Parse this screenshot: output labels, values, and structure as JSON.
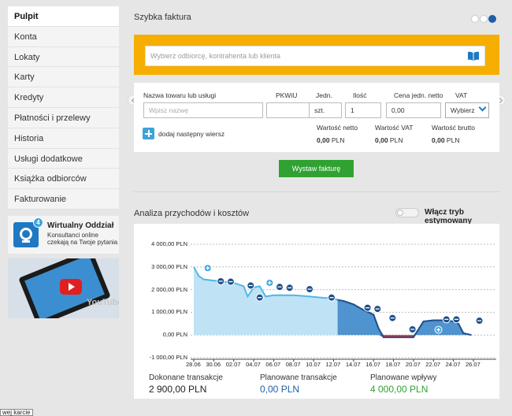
{
  "sidebar": {
    "items": [
      {
        "label": "Pulpit",
        "active": true
      },
      {
        "label": "Konta"
      },
      {
        "label": "Lokaty"
      },
      {
        "label": "Karty"
      },
      {
        "label": "Kredyty"
      },
      {
        "label": "Płatności i przelewy"
      },
      {
        "label": "Historia"
      },
      {
        "label": "Usługi dodatkowe"
      },
      {
        "label": "Książka odbiorców"
      },
      {
        "label": "Fakturowanie"
      }
    ],
    "virtual_office": {
      "badge": "4",
      "title": "Wirtualny Oddział",
      "subtitle": "Konsultanci online czekają na Twoje pytania"
    },
    "video": {
      "watermark": "YouTube"
    }
  },
  "invoice": {
    "title": "Szybka faktura",
    "carousel_dots": 3,
    "recipient_placeholder": "Wybierz odbiorcę, kontrahenta lub klienta",
    "columns": {
      "name": "Nazwa towaru lub usługi",
      "pkwiu": "PKWiU",
      "unit": "Jedn.",
      "qty": "Ilość",
      "price": "Cena jedn. netto",
      "vat": "VAT"
    },
    "row": {
      "name_placeholder": "Wpisz nazwę",
      "unit": "szt.",
      "qty": "1",
      "price": "0,00",
      "vat": "Wybierz"
    },
    "add_row": "dodaj następny wiersz",
    "totals": [
      {
        "label": "Wartość netto",
        "value": "0,00",
        "currency": "PLN"
      },
      {
        "label": "Wartość VAT",
        "value": "0,00",
        "currency": "PLN"
      },
      {
        "label": "Wartość brutto",
        "value": "0,00",
        "currency": "PLN"
      }
    ],
    "submit": "Wystaw fakturę"
  },
  "analysis": {
    "title": "Analiza przychodów i kosztów",
    "toggle_label": "Włącz tryb estymowany",
    "toggle_on": false,
    "stats": [
      {
        "label": "Dokonane transakcje",
        "value": "2 900,00 PLN",
        "color": "#222222"
      },
      {
        "label": "Planowane transakcje",
        "value": "0,00 PLN",
        "color": "#1e5fa8"
      },
      {
        "label": "Planowane wpływy",
        "value": "4 000,00 PLN",
        "color": "#2fa232"
      }
    ]
  },
  "chart_data": {
    "type": "area",
    "y_tick_labels": [
      "4 000,00 PLN",
      "3 000,00 PLN",
      "2 000,00 PLN",
      "1 000,00 PLN",
      "0,00 PLN",
      "-1 000,00 PLN"
    ],
    "y_ticks": [
      4000,
      3000,
      2000,
      1000,
      0,
      -1000
    ],
    "ylim": [
      -1000,
      4000
    ],
    "x_tick_labels": [
      "28.06",
      "30.06",
      "02.07",
      "04.07",
      "06.07",
      "08.07",
      "10.07",
      "12.07",
      "14.07",
      "16.07",
      "18.07",
      "20.07",
      "22.07",
      "24.07",
      "26.07"
    ],
    "x_days": [
      0,
      2,
      4,
      6,
      8,
      10,
      12,
      14,
      16,
      18,
      20,
      22,
      24,
      26,
      28
    ],
    "series": [
      {
        "kind": "actual",
        "points": [
          [
            0,
            3000
          ],
          [
            0.5,
            2600
          ],
          [
            1,
            2450
          ],
          [
            2,
            2400
          ],
          [
            3,
            2350
          ],
          [
            4,
            2300
          ],
          [
            5,
            2150
          ],
          [
            5.4,
            1700
          ],
          [
            6,
            2100
          ],
          [
            6.6,
            2150
          ],
          [
            7.2,
            1700
          ],
          [
            8,
            1750
          ],
          [
            9,
            1750
          ],
          [
            10,
            1750
          ],
          [
            11,
            1720
          ],
          [
            12,
            1680
          ],
          [
            13,
            1640
          ],
          [
            14,
            1620
          ],
          [
            14.4,
            1550
          ]
        ],
        "color": "#4db8e6"
      },
      {
        "kind": "planned",
        "points": [
          [
            14.4,
            1550
          ],
          [
            15,
            1500
          ],
          [
            16,
            1350
          ],
          [
            17,
            1100
          ],
          [
            18,
            900
          ],
          [
            18.5,
            300
          ],
          [
            19,
            -100
          ],
          [
            20,
            -100
          ],
          [
            21,
            -100
          ],
          [
            22,
            -100
          ],
          [
            22.5,
            250
          ],
          [
            23,
            600
          ],
          [
            24,
            650
          ],
          [
            25,
            650
          ],
          [
            26,
            600
          ],
          [
            26.5,
            500
          ],
          [
            27,
            80
          ],
          [
            27.8,
            0
          ]
        ],
        "color": "#1d4f8c"
      }
    ],
    "markers": [
      {
        "x": 1.4,
        "y": 2950,
        "kind": "plus"
      },
      {
        "x": 2.7,
        "y": 2370,
        "kind": "minus"
      },
      {
        "x": 3.7,
        "y": 2350,
        "kind": "minus"
      },
      {
        "x": 5.7,
        "y": 2180,
        "kind": "minus"
      },
      {
        "x": 6.6,
        "y": 1650,
        "kind": "minus"
      },
      {
        "x": 7.6,
        "y": 2300,
        "kind": "plus"
      },
      {
        "x": 8.6,
        "y": 2120,
        "kind": "minus"
      },
      {
        "x": 9.6,
        "y": 2080,
        "kind": "minus"
      },
      {
        "x": 11.6,
        "y": 2020,
        "kind": "minus"
      },
      {
        "x": 13.8,
        "y": 1650,
        "kind": "minus"
      },
      {
        "x": 17.4,
        "y": 1200,
        "kind": "minus"
      },
      {
        "x": 18.4,
        "y": 1150,
        "kind": "minus"
      },
      {
        "x": 19.9,
        "y": 750,
        "kind": "minus"
      },
      {
        "x": 21.9,
        "y": 250,
        "kind": "minus"
      },
      {
        "x": 24.5,
        "y": 230,
        "kind": "plus"
      },
      {
        "x": 25.3,
        "y": 690,
        "kind": "minus"
      },
      {
        "x": 26.3,
        "y": 690,
        "kind": "minus"
      },
      {
        "x": 28.6,
        "y": 630,
        "kind": "minus"
      }
    ]
  }
}
